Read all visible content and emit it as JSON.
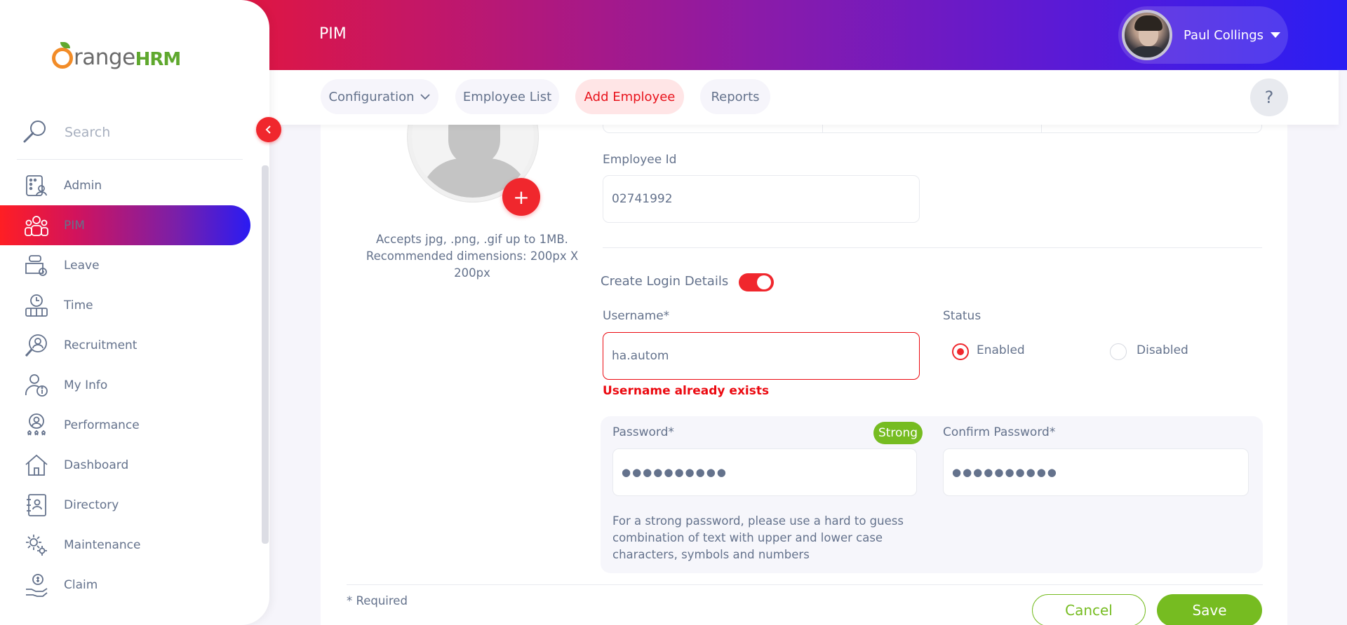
{
  "brand": {
    "name_part": "range",
    "name_suffix": "HRM"
  },
  "header": {
    "module_title": "PIM",
    "user_name": "Paul Collings"
  },
  "sidebar": {
    "search_placeholder": "Search",
    "items": [
      {
        "label": "Admin",
        "icon": "admin-icon"
      },
      {
        "label": "PIM",
        "icon": "pim-icon",
        "active": true
      },
      {
        "label": "Leave",
        "icon": "leave-icon"
      },
      {
        "label": "Time",
        "icon": "time-icon"
      },
      {
        "label": "Recruitment",
        "icon": "recruitment-icon"
      },
      {
        "label": "My Info",
        "icon": "my-info-icon"
      },
      {
        "label": "Performance",
        "icon": "performance-icon"
      },
      {
        "label": "Dashboard",
        "icon": "dashboard-icon"
      },
      {
        "label": "Directory",
        "icon": "directory-icon"
      },
      {
        "label": "Maintenance",
        "icon": "maintenance-icon"
      },
      {
        "label": "Claim",
        "icon": "claim-icon"
      }
    ]
  },
  "topnav": {
    "tabs": [
      {
        "label": "Configuration"
      },
      {
        "label": "Employee List"
      },
      {
        "label": "Add Employee",
        "active": true
      },
      {
        "label": "Reports"
      }
    ],
    "help_label": "?"
  },
  "form": {
    "photo_hint": "Accepts jpg, .png, .gif up to 1MB. Recommended dimensions: 200px X 200px",
    "add_photo_label": "+",
    "employee_id": {
      "label": "Employee Id",
      "value": "02741992"
    },
    "create_login": {
      "label": "Create Login Details",
      "enabled": true
    },
    "username": {
      "label": "Username*",
      "value": "ha.autom",
      "error": "Username already exists"
    },
    "status": {
      "label": "Status",
      "options": [
        "Enabled",
        "Disabled"
      ],
      "selected": "Enabled"
    },
    "password": {
      "label": "Password*",
      "value": "●●●●●●●●●●",
      "strength": "Strong"
    },
    "confirm_password": {
      "label": "Confirm Password*",
      "value": "●●●●●●●●●●"
    },
    "password_hint": "For a strong password, please use a hard to guess combination of text with upper and lower case characters, symbols and numbers",
    "required_note": "* Required",
    "cancel_label": "Cancel",
    "save_label": "Save"
  },
  "colors": {
    "accent": "#f0272d",
    "success": "#76bc21",
    "text": "#64728c",
    "error": "#eb0910"
  }
}
